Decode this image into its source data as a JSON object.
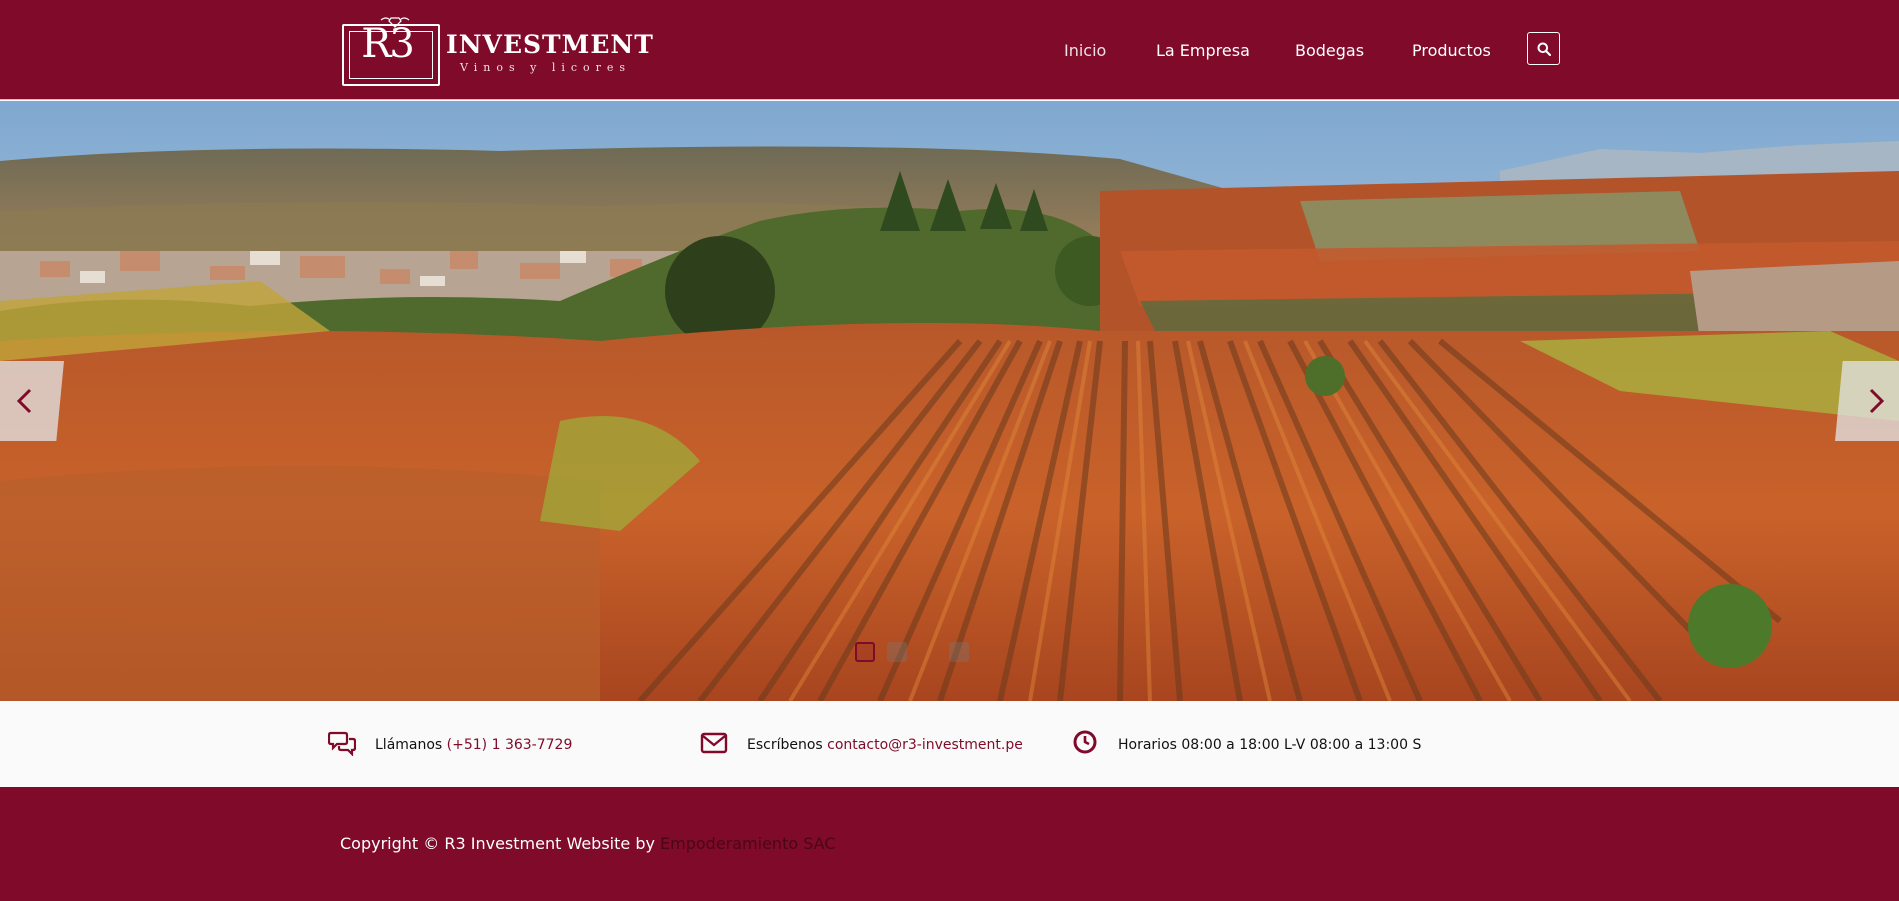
{
  "brand": {
    "monogram": "R3",
    "name": "INVESTMENT",
    "tagline": "Vinos y licores"
  },
  "nav": {
    "items": [
      {
        "label": "Inicio",
        "active": true
      },
      {
        "label": "La Empresa",
        "active": false
      },
      {
        "label": "Bodegas",
        "active": false
      },
      {
        "label": "Productos",
        "active": false
      }
    ],
    "search_icon": "search-icon"
  },
  "slider": {
    "prev_icon": "chevron-left-icon",
    "next_icon": "chevron-right-icon",
    "slide_count": 3,
    "active_slide": 1
  },
  "contact": {
    "phone_label": "Llámanos",
    "phone_value": "(+51) 1 363-7729",
    "email_label": "Escríbenos",
    "email_value": "contacto@r3-investment.pe",
    "hours_label": "Horarios 08:00 a 18:00 L-V 08:00 a 13:00 S"
  },
  "footer": {
    "copyright": "Copyright © R3 Investment Website by",
    "author": "Empoderamiento SAC"
  },
  "colors": {
    "brand": "#7f0a29",
    "info_bar": "#fafafa",
    "footer_link": "#4a0618"
  }
}
